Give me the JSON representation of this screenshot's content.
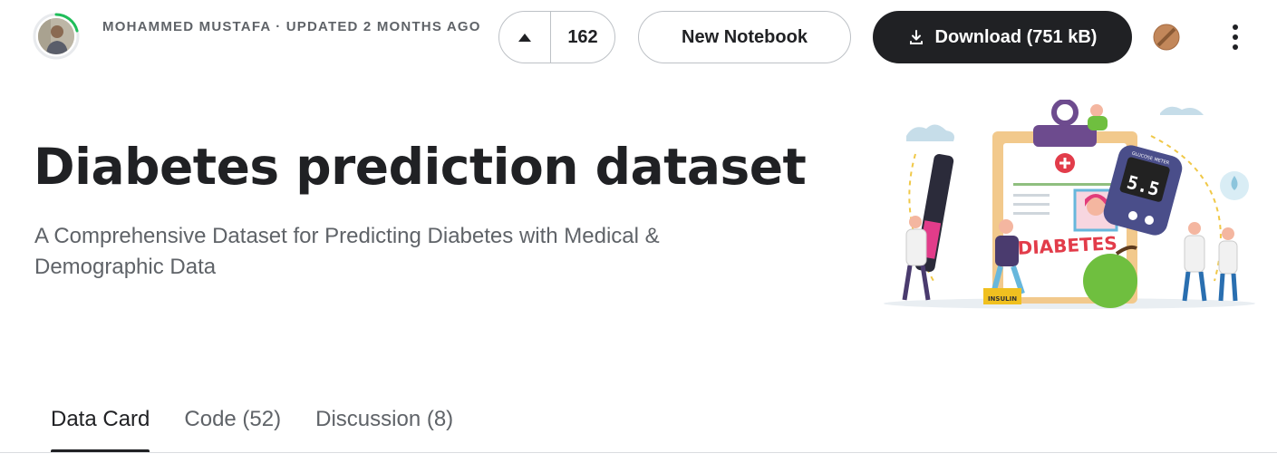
{
  "header": {
    "author_meta": "MOHAMMED MUSTAFA · UPDATED 2 MONTHS AGO",
    "vote_count": "162",
    "new_notebook_label": "New Notebook",
    "download_label": "Download (751 kB)"
  },
  "dataset": {
    "title": "Diabetes prediction dataset",
    "subtitle": "A Comprehensive Dataset for Predicting Diabetes with Medical & Demographic Data",
    "image_text": {
      "banner": "DIABETES",
      "meter_reading": "5.5",
      "meter_caption": "GLUCOSE METER",
      "box_label": "INSULIN"
    }
  },
  "tabs": [
    {
      "label": "Data Card",
      "active": true
    },
    {
      "label": "Code (52)",
      "active": false
    },
    {
      "label": "Discussion (8)",
      "active": false
    }
  ],
  "icons": {
    "vote": "triangle-up-icon",
    "download": "download-icon",
    "medal": "bronze-medal-icon",
    "menu": "kebab-menu-icon"
  },
  "colors": {
    "primary_button": "#202124",
    "progress_ring": "#20be5a",
    "medal": "#c2875a",
    "divider": "#dadce0"
  }
}
